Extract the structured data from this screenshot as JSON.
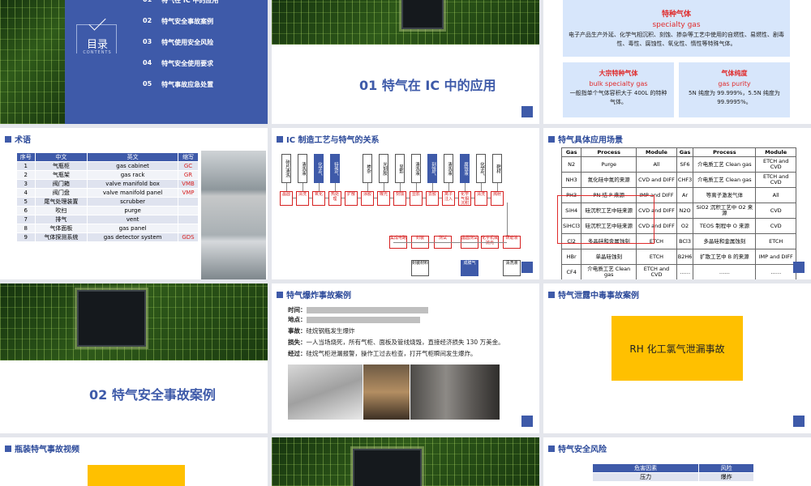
{
  "toc": {
    "title": "目录",
    "sub": "CONTENTS",
    "items": [
      {
        "num": "01",
        "label": "特气在 IC 中的应用"
      },
      {
        "num": "02",
        "label": "特气安全事故案例"
      },
      {
        "num": "03",
        "label": "特气使用安全风险"
      },
      {
        "num": "04",
        "label": "特气安全使用要求"
      },
      {
        "num": "05",
        "label": "特气事故应急处置"
      }
    ]
  },
  "section1": "01 特气在 IC 中的应用",
  "specialty": {
    "title": "特种气体",
    "sub": "specialty gas",
    "desc": "电子产品生产外延、化学气相沉积、刻蚀、掺杂等工艺中使用的自燃性、易燃性、剧毒性、毒性、腐蚀性、氧化性、惰性等特殊气体。",
    "bulk": {
      "title": "大宗特种气体",
      "sub": "bulk specialty gas",
      "desc": "一般指单个气体容积大于 400L 的特种气体。"
    },
    "purity": {
      "title": "气体纯度",
      "sub": "gas purity",
      "desc": "5N 纯度为 99.999%，5.5N 纯度为 99.9995%。"
    }
  },
  "terms": {
    "header": "术语",
    "cols": [
      "序号",
      "中文",
      "英文",
      "缩写"
    ],
    "rows": [
      [
        "1",
        "气瓶柜",
        "gas cabinet",
        "GC"
      ],
      [
        "2",
        "气瓶架",
        "gas rack",
        "GR"
      ],
      [
        "3",
        "阀门箱",
        "valve manifold box",
        "VMB"
      ],
      [
        "4",
        "阀门盘",
        "valve manifold panel",
        "VMP"
      ],
      [
        "5",
        "尾气处理装置",
        "scrubber",
        ""
      ],
      [
        "6",
        "吹扫",
        "purge",
        ""
      ],
      [
        "7",
        "排气",
        "vent",
        ""
      ],
      [
        "8",
        "气体面板",
        "gas panel",
        ""
      ],
      [
        "9",
        "气体探测系统",
        "gas detector system",
        "GDS"
      ]
    ]
  },
  "process": {
    "header": "IC 制造工艺与特气的关系",
    "top": [
      "硅片清洗",
      "清洗液",
      "化学气",
      "特殊气",
      "",
      "掺杂",
      "光刻胶",
      "显影",
      "清洗液",
      "刻蚀气",
      "清洗液",
      "腐蚀液",
      "化学气",
      "靶材"
    ],
    "mid": [
      "晶圆",
      "清洗",
      "氧化",
      "热处理",
      "扩散",
      "涂胶",
      "曝光",
      "刻蚀",
      "显影",
      "去胶",
      "离子注入",
      "化学气相沉积",
      "清洗",
      "溅射"
    ],
    "bot": [
      "集成电路",
      "封装",
      "测试",
      "晶圆测试",
      "化学机械抛光",
      "研磨液"
    ],
    "bot2": [
      "封装材料",
      "成膜气",
      "清洗液"
    ]
  },
  "app": {
    "header": "特气具体应用场景",
    "cols": [
      "Gas",
      "Process",
      "Module",
      "Gas",
      "Process",
      "Module"
    ],
    "rows": [
      [
        "N2",
        "Purge",
        "All",
        "SF6",
        "介电质工艺 Clean gas",
        "ETCH and CVD"
      ],
      [
        "NH3",
        "氮化硅中氮的来源",
        "CVD and DIFF",
        "CHF3",
        "介电质工艺 Clean gas",
        "ETCH and CVD"
      ],
      [
        "PH3",
        "PN 结 P 来源",
        "IMP and DIFF",
        "Ar",
        "等离子激发气体",
        "All"
      ],
      [
        "SiH4",
        "硅沉积工艺中硅来源",
        "CVD and DIFF",
        "N2O",
        "SiO2 沉积工艺中 O2 来源",
        "CVD"
      ],
      [
        "SiHCl3",
        "硅沉积工艺中硅来源",
        "CVD and DIFF",
        "O2",
        "TEOS 制程中 O 来源",
        "CVD"
      ],
      [
        "Cl2",
        "多晶硅和金属蚀刻",
        "ETCH",
        "BCl3",
        "多晶硅和金属蚀刻",
        "ETCH"
      ],
      [
        "HBr",
        "单晶硅蚀刻",
        "ETCH",
        "B2H6",
        "扩散工艺中 B 的来源",
        "IMP and DIFF"
      ],
      [
        "CF4",
        "介电质工艺 Clean gas",
        "ETCH and CVD",
        "……",
        "……",
        "……"
      ]
    ]
  },
  "section2": "02 特气安全事故案例",
  "explosion": {
    "header": "特气爆炸事故案例",
    "time_label": "时间：",
    "place_label": "地点：",
    "event_label": "事故：",
    "event": "硅烷钢瓶发生爆炸",
    "loss_label": "损失：",
    "loss": "一人当场烧死，所有气柜、面板及管线烧毁，直接经济损失 130 万美金。",
    "cause_label": "经过：",
    "cause": "硅烷气柜泄漏报警，操作工过去检查，打开气柜瞬间发生爆炸。"
  },
  "leak": {
    "header": "特气泄露中毒事故案例",
    "label": "RH 化工氯气泄漏事故"
  },
  "video": {
    "header": "瓶装特气事故视频"
  },
  "risk": {
    "header": "特气安全风险",
    "cols": [
      "危害因素",
      "风险"
    ],
    "rows": [
      [
        "压力",
        "爆炸"
      ]
    ]
  },
  "colors": {
    "accent": "#3e5aa9",
    "alert": "#e02a2a",
    "highlight": "#ffc000"
  }
}
